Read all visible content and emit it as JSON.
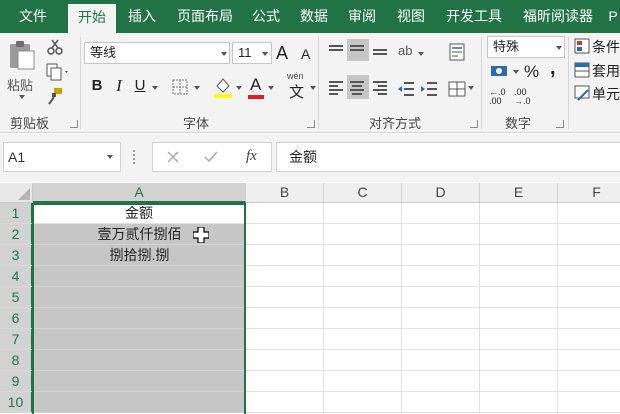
{
  "tabs": [
    {
      "label": "文件",
      "active": false
    },
    {
      "label": "开始",
      "active": true
    },
    {
      "label": "插入",
      "active": false
    },
    {
      "label": "页面布局",
      "active": false
    },
    {
      "label": "公式",
      "active": false
    },
    {
      "label": "数据",
      "active": false
    },
    {
      "label": "审阅",
      "active": false
    },
    {
      "label": "视图",
      "active": false
    },
    {
      "label": "开发工具",
      "active": false
    },
    {
      "label": "福昕阅读器",
      "active": false
    },
    {
      "label": "P",
      "active": false
    }
  ],
  "ribbon": {
    "clipboard": {
      "paste_label": "粘贴",
      "group_label": "剪贴板"
    },
    "font": {
      "font_name": "等线",
      "font_size": "11",
      "bold": "B",
      "italic": "I",
      "underline": "U",
      "font_color_glyph": "A",
      "phonetic_top": "wén",
      "phonetic_char": "文",
      "grow": "A",
      "shrink": "A",
      "group_label": "字体"
    },
    "alignment": {
      "group_label": "对齐方式",
      "orientation_glyph": "ab"
    },
    "number": {
      "format": "特殊",
      "percent": "%",
      "comma": ",",
      "inc_decimal": "←.0 .00",
      "dec_decimal": ".00 →.0",
      "group_label": "数字"
    },
    "styles": {
      "conditional": "条件",
      "table": "套用",
      "cell": "单元"
    }
  },
  "formula_bar": {
    "name_box": "A1",
    "fx": "fx",
    "content": "金额"
  },
  "columns": [
    {
      "label": "A",
      "selected": true
    },
    {
      "label": "B",
      "selected": false
    },
    {
      "label": "C",
      "selected": false
    },
    {
      "label": "D",
      "selected": false
    },
    {
      "label": "E",
      "selected": false
    },
    {
      "label": "F",
      "selected": false
    }
  ],
  "rows": [
    {
      "num": "1",
      "a": "金额"
    },
    {
      "num": "2",
      "a": "壹万贰仟捌佰"
    },
    {
      "num": "3",
      "a": "捌拾捌.捌"
    },
    {
      "num": "4",
      "a": ""
    },
    {
      "num": "5",
      "a": ""
    },
    {
      "num": "6",
      "a": ""
    },
    {
      "num": "7",
      "a": ""
    },
    {
      "num": "8",
      "a": ""
    },
    {
      "num": "9",
      "a": ""
    },
    {
      "num": "10",
      "a": ""
    }
  ],
  "colors": {
    "accent": "#217346",
    "selection_fill": "#c6c6c6"
  }
}
